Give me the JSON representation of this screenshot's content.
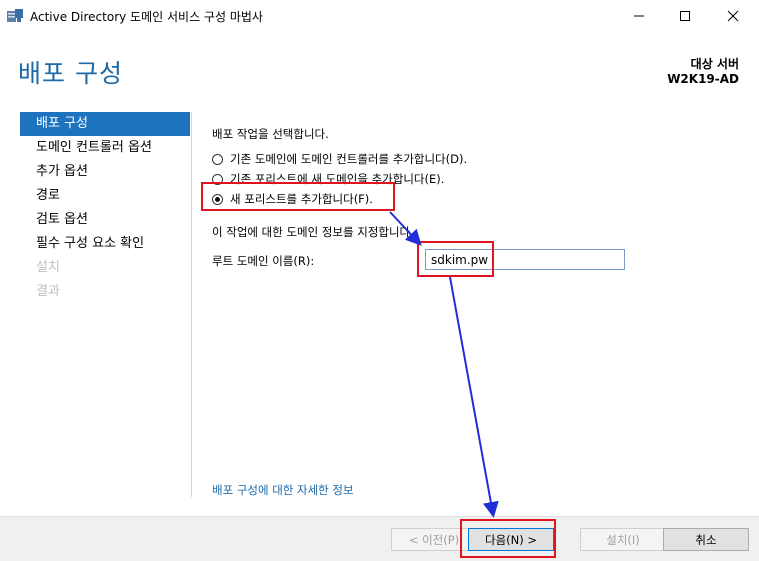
{
  "window": {
    "title": "Active Directory 도메인 서비스 구성 마법사",
    "icon": "server-tool-icon"
  },
  "header": {
    "title": "배포 구성",
    "target_label": "대상 서버",
    "target_name": "W2K19-AD"
  },
  "sidebar": {
    "items": [
      {
        "label": "배포 구성",
        "state": "active"
      },
      {
        "label": "도메인 컨트롤러 옵션",
        "state": "enabled"
      },
      {
        "label": "추가 옵션",
        "state": "enabled"
      },
      {
        "label": "경로",
        "state": "enabled"
      },
      {
        "label": "검토 옵션",
        "state": "enabled"
      },
      {
        "label": "필수 구성 요소 확인",
        "state": "enabled"
      },
      {
        "label": "설치",
        "state": "disabled"
      },
      {
        "label": "결과",
        "state": "disabled"
      }
    ]
  },
  "main": {
    "prompt": "배포 작업을 선택합니다.",
    "options": [
      {
        "label": "기존 도메인에 도메인 컨트롤러를 추가합니다(D).",
        "checked": false
      },
      {
        "label": "기존 포리스트에 새 도메인을 추가합니다(E).",
        "checked": false
      },
      {
        "label": "새 포리스트를 추가합니다(F).",
        "checked": true
      }
    ],
    "info_text": "이 작업에 대한 도메인 정보를 지정합니다.",
    "root_domain_label": "루트 도메인 이름(R):",
    "root_domain_value": "sdkim.pw",
    "more_info_link": "배포 구성에 대한 자세한 정보"
  },
  "footer": {
    "prev_label": "< 이전(P)",
    "next_label": "다음(N) >",
    "install_label": "설치(I)",
    "cancel_label": "취소"
  },
  "colors": {
    "accent": "#1e73be",
    "header_text": "#1e6aa8",
    "annotation_red": "#e0141e",
    "annotation_arrow": "#1f2ed6"
  }
}
